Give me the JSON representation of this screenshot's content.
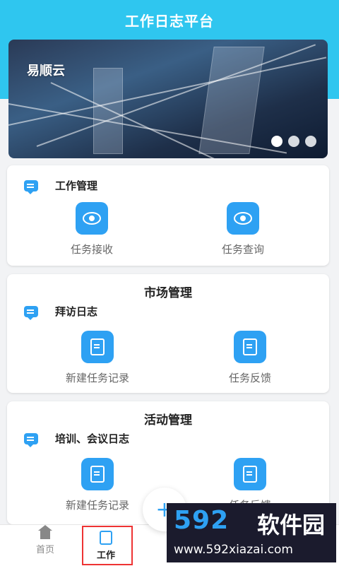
{
  "header": {
    "title": "工作日志平台"
  },
  "banner": {
    "brand": "易顺云",
    "slide_count": 3,
    "active_slide": 1
  },
  "cards": [
    {
      "title": "",
      "row_label": "工作管理",
      "actions": [
        {
          "label": "任务接收",
          "icon": "eye-icon"
        },
        {
          "label": "任务查询",
          "icon": "eye-icon"
        }
      ]
    },
    {
      "title": "市场管理",
      "row_label": "拜访日志",
      "actions": [
        {
          "label": "新建任务记录",
          "icon": "document-icon"
        },
        {
          "label": "任务反馈",
          "icon": "document-icon"
        }
      ]
    },
    {
      "title": "活动管理",
      "row_label": "培训、会议日志",
      "actions": [
        {
          "label": "新建任务记录",
          "icon": "document-icon"
        },
        {
          "label": "任务反馈",
          "icon": "document-icon"
        }
      ]
    }
  ],
  "fab": {
    "label": "+"
  },
  "tabbar": {
    "tabs": [
      {
        "label": "首页",
        "icon": "home-icon",
        "active": false
      },
      {
        "label": "工作",
        "icon": "work-icon",
        "active": true
      }
    ]
  },
  "watermark": {
    "number": "592",
    "name": "软件园",
    "url": "www.592xiazai.com"
  },
  "colors": {
    "header": "#2fc6ef",
    "accent": "#2ea1f3",
    "highlight": "#e33333"
  }
}
